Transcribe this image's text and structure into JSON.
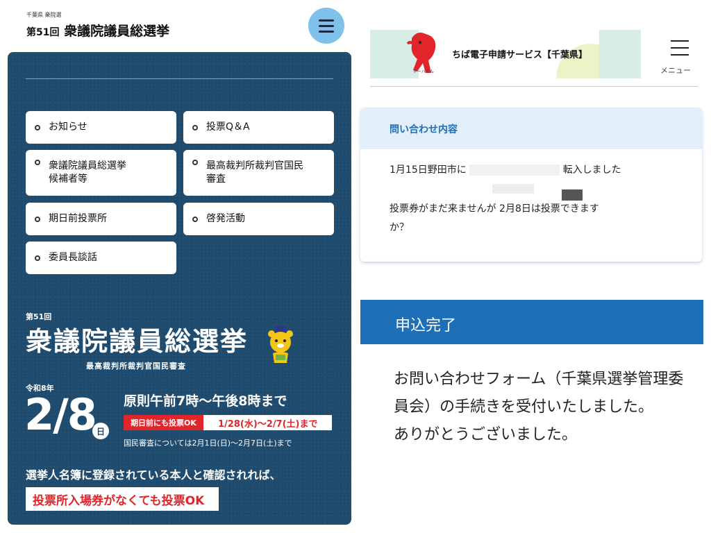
{
  "left": {
    "small_caption": "千葉県 衆院選",
    "title_num": "第51回",
    "title": "衆議院議員総選挙",
    "nav": [
      {
        "label": "お知らせ"
      },
      {
        "label": "投票Q＆A"
      },
      {
        "label": "衆議院議員総選挙\n候補者等"
      },
      {
        "label": "最高裁判所裁判官国民\n審査"
      },
      {
        "label": "期日前投票所"
      },
      {
        "label": "啓発活動"
      },
      {
        "label": "委員長談話"
      }
    ],
    "hero": {
      "num": "第51回",
      "title": "衆議院議員総選挙",
      "subtitle": "最高裁判所裁判官国民審査",
      "era": "令和8年",
      "date": "2/8",
      "day": "日",
      "hours": "原則午前7時～午後8時まで",
      "early_label": "期日前にも投票OK",
      "early_dates": "1/28(水)～2/7(土)まで",
      "review_note": "国民審査については2月1日(日)～2月7日(土)まで",
      "voter_note": "選挙人名簿に登録されている本人と確認されれば、",
      "no_ticket": "投票所入場券がなくても投票OK"
    }
  },
  "right": {
    "mascot_name": "チーバくん",
    "service_title": "ちば電子申請サービス【千葉県】",
    "menu_label": "メニュー",
    "inquiry_label": "問い合わせ内容",
    "inquiry_line1_a": "1月15日野田市に",
    "inquiry_line1_b": "転入しました",
    "inquiry_line2_a": "投票券がまだ来ませんが",
    "inquiry_line2_b": "2月8日は投票できます",
    "inquiry_line3": "か？",
    "done_label": "申込完了",
    "done_message": "お問い合わせフォーム（千葉県選挙管理委員会）の手続きを受付いたしました。\nありがとうございました。"
  },
  "colors": {
    "board": "#1f4b6e",
    "menu_circle": "#7fc1ea",
    "accent_red": "#e2242b",
    "accent_blue": "#1d6fb8",
    "inquiry_head": "#e2eef9"
  },
  "icons": [
    "hamburger-icon",
    "bullet-circle-icon",
    "mascot-illustration",
    "chiba-mascot-illustration"
  ]
}
